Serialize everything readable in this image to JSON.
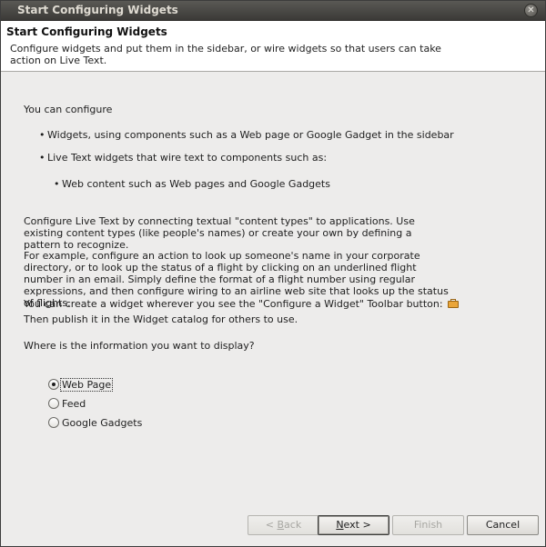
{
  "window": {
    "title": "Start Configuring Widgets",
    "close_glyph": "✕"
  },
  "header": {
    "title": "Start Configuring Widgets",
    "description": "Configure widgets and put them in the sidebar, or wire widgets so that users can take action on Live Text."
  },
  "main": {
    "intro": "You can configure",
    "bullets": [
      "Widgets, using components such as a Web page or Google Gadget in the sidebar",
      "Live Text widgets that wire text to components such as:"
    ],
    "sub_bullets": [
      "Web content such as Web pages and Google Gadgets"
    ],
    "paragraph1": "Configure Live Text by connecting textual \"content types\" to applications. Use existing content types (like people's names) or create your own by defining a pattern to recognize.",
    "paragraph2": "For example, configure an action to look up someone's name in your corporate directory, or to look up the status of a flight by clicking on an underlined flight number in an email. Simply define the format of a flight number using regular expressions, and then configure wiring to an airline web site that looks up the status of flights.",
    "toolbar_line": "You can create a widget wherever you see the \"Configure a Widget\" Toolbar button:",
    "toolbar_icon": "briefcase-icon",
    "publish_line": "Then publish it in the Widget catalog for others to use.",
    "question": "Where is the information you want to display?",
    "options": [
      {
        "label": "Web Page",
        "selected": true
      },
      {
        "label": "Feed",
        "selected": false
      },
      {
        "label": "Google Gadgets",
        "selected": false
      }
    ]
  },
  "buttons": {
    "back": {
      "mnemonic": "B",
      "rest": "ack",
      "prefix": "< ",
      "enabled": false
    },
    "next": {
      "mnemonic": "N",
      "rest": "ext >",
      "enabled": true
    },
    "finish": {
      "label": "Finish",
      "enabled": false
    },
    "cancel": {
      "label": "Cancel",
      "enabled": true
    }
  },
  "colors": {
    "background": "#edeceb",
    "titlebar": "#3b3a37",
    "header_bg": "#ffffff"
  }
}
